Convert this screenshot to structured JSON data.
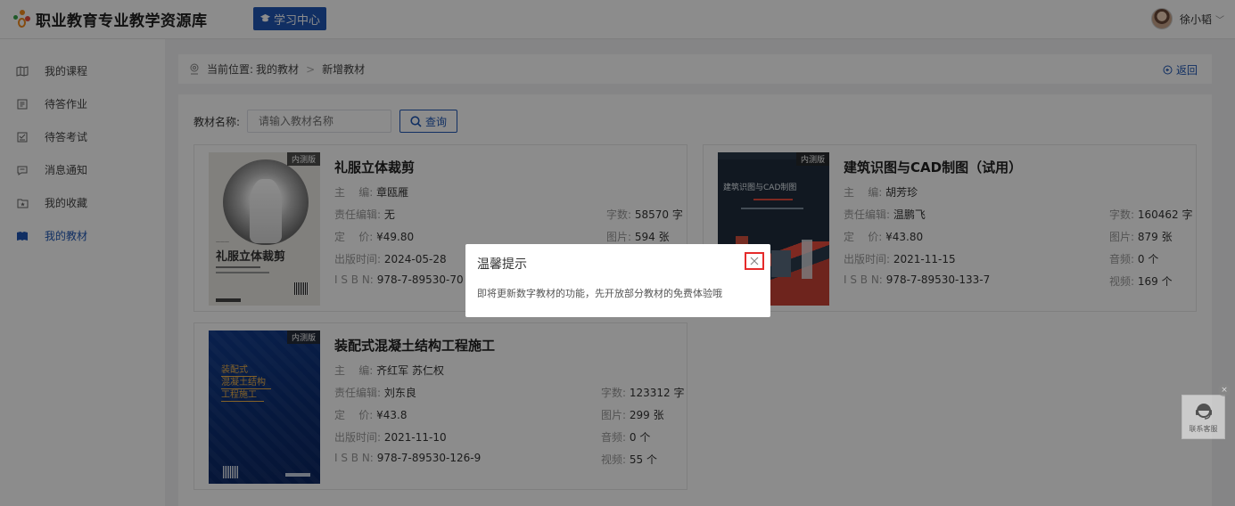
{
  "header": {
    "site_title": "职业教育专业教学资源库",
    "learning_center": "学习中心",
    "user_name": "徐小韬"
  },
  "sidebar": {
    "items": [
      {
        "label": "我的课程",
        "icon": "course-icon"
      },
      {
        "label": "待答作业",
        "icon": "homework-icon"
      },
      {
        "label": "待答考试",
        "icon": "exam-icon"
      },
      {
        "label": "消息通知",
        "icon": "message-icon"
      },
      {
        "label": "我的收藏",
        "icon": "favorite-icon"
      },
      {
        "label": "我的教材",
        "icon": "textbook-icon"
      }
    ],
    "active_index": 5
  },
  "breadcrumb": {
    "prefix": "当前位置:",
    "items": [
      "我的教材",
      "新增教材"
    ],
    "back": "返回"
  },
  "search": {
    "label": "教材名称:",
    "placeholder": "请输入教材名称",
    "button": "查询"
  },
  "labels": {
    "editor": "主    编:",
    "resp_editor": "责任编辑:",
    "price": "定    价:",
    "pub_date": "出版时间:",
    "isbn": "I S B N:",
    "words": "字数:",
    "images": "图片:",
    "audio": "音频:",
    "video": "视频:",
    "tag": "内测版"
  },
  "books": [
    {
      "title": "礼服立体裁剪",
      "editor": "章瓯雁",
      "resp_editor": "无",
      "price": "¥49.80",
      "pub_date": "2024-05-28",
      "isbn": "978-7-89530-70",
      "words": "58570 字",
      "images": "594 张",
      "cover_text": "礼服立体裁剪"
    },
    {
      "title": "建筑识图与CAD制图（试用）",
      "editor": "胡芳珍",
      "resp_editor": "温鹏飞",
      "price": "¥43.80",
      "pub_date": "2021-11-15",
      "isbn": "978-7-89530-133-7",
      "words": "160462 字",
      "images": "879 张",
      "audio": "0 个",
      "video": "169 个",
      "cover_text": "建筑识图与CAD制图"
    },
    {
      "title": "装配式混凝土结构工程施工",
      "editor": "齐红军 苏仁权",
      "resp_editor": "刘东良",
      "price": "¥43.8",
      "pub_date": "2021-11-10",
      "isbn": "978-7-89530-126-9",
      "words": "123312 字",
      "images": "299 张",
      "audio": "0 个",
      "video": "55 个",
      "cover_lines": [
        "装配式",
        "混凝土结构",
        "工程施工"
      ]
    }
  ],
  "dialog": {
    "title": "温馨提示",
    "message": "即将更新数字教材的功能，先开放部分教材的免费体验哦"
  },
  "service": {
    "label": "联系客服"
  },
  "colors": {
    "brand": "#1f57b4",
    "highlight": "#e52b2b"
  }
}
